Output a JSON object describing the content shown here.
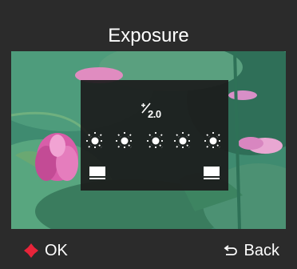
{
  "screen": {
    "title": "Exposure"
  },
  "exposure": {
    "icon": "exposure-compensation-icon",
    "value": "2.0",
    "levels": 5,
    "left_icon": "flash-icon",
    "right_icon": "flash-icon"
  },
  "footer": {
    "ok_icon": "dpad-icon",
    "ok_label": "OK",
    "back_icon": "back-arrow-icon",
    "back_label": "Back"
  },
  "colors": {
    "background": "#2b2b2b",
    "accent_ok": "#e8243a",
    "panel": "#1c1c1c",
    "text": "#ffffff"
  }
}
